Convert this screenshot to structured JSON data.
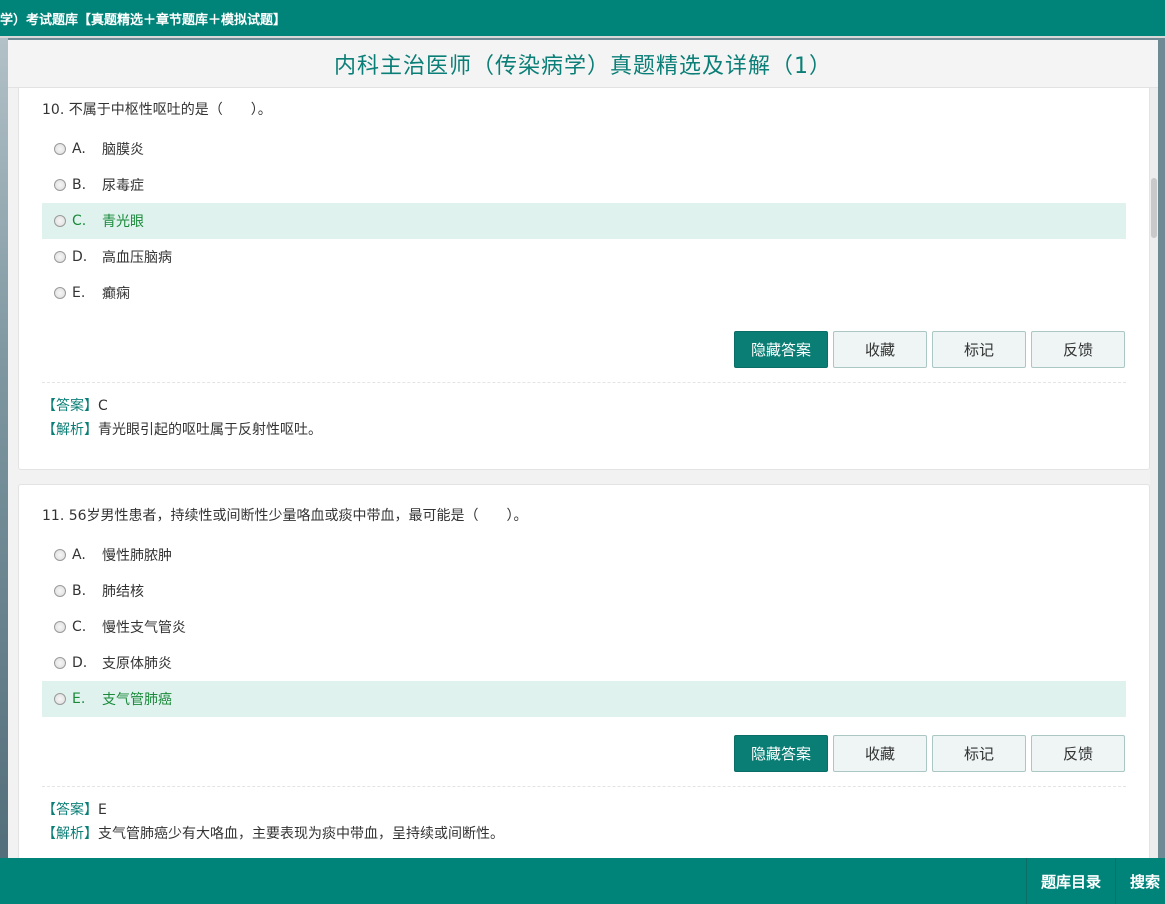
{
  "topbar": {
    "title": "学）考试题库【真题精选＋章节题库＋模拟试题】"
  },
  "header": {
    "title": "内科主治医师（传染病学）真题精选及详解（1）"
  },
  "buttons": {
    "hide_answer": "隐藏答案",
    "favorite": "收藏",
    "mark": "标记",
    "feedback": "反馈"
  },
  "labels": {
    "answer_tag": "【答案】",
    "analysis_tag": "【解析】"
  },
  "questions": [
    {
      "title": "10. 不属于中枢性呕吐的是（　　）。",
      "options": [
        {
          "letter": "A.",
          "text": "脑膜炎"
        },
        {
          "letter": "B.",
          "text": "尿毒症"
        },
        {
          "letter": "C.",
          "text": "青光眼"
        },
        {
          "letter": "D.",
          "text": "高血压脑病"
        },
        {
          "letter": "E.",
          "text": "癫痫"
        }
      ],
      "correct_index": 2,
      "answer": "C",
      "analysis": "青光眼引起的呕吐属于反射性呕吐。"
    },
    {
      "title": "11. 56岁男性患者，持续性或间断性少量咯血或痰中带血，最可能是（　　）。",
      "options": [
        {
          "letter": "A.",
          "text": "慢性肺脓肿"
        },
        {
          "letter": "B.",
          "text": "肺结核"
        },
        {
          "letter": "C.",
          "text": "慢性支气管炎"
        },
        {
          "letter": "D.",
          "text": "支原体肺炎"
        },
        {
          "letter": "E.",
          "text": "支气管肺癌"
        }
      ],
      "correct_index": 4,
      "answer": "E",
      "analysis": "支气管肺癌少有大咯血，主要表现为痰中带血，呈持续或间断性。"
    }
  ],
  "bottom_nav": {
    "catalog": "题库目录",
    "search": "搜索"
  }
}
